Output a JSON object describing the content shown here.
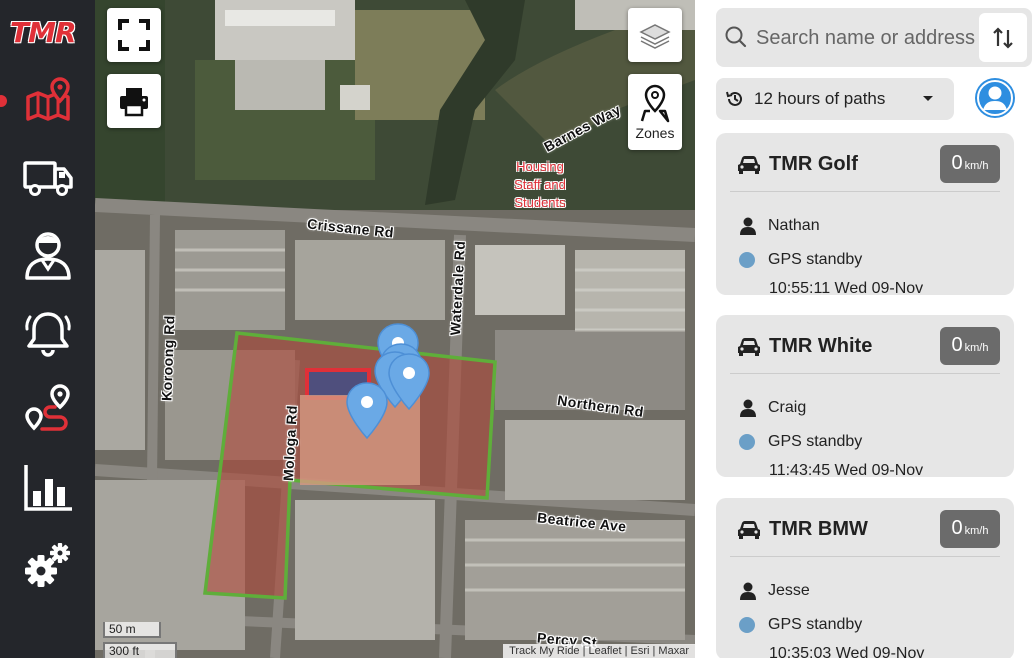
{
  "app": {
    "logo_text": "TMR"
  },
  "colors": {
    "brand_red": "#e03038",
    "sidebar_bg": "#24262b",
    "status_standby": "#6b9fc7",
    "speed_badge": "#6b6b6b",
    "avatar_blue": "#2e8ee0",
    "zone_green": "#5fae3a"
  },
  "sidebar": {
    "items": [
      {
        "name": "map",
        "icon": "map-pin-icon",
        "active": true
      },
      {
        "name": "vehicles",
        "icon": "truck-icon"
      },
      {
        "name": "drivers",
        "icon": "driver-icon"
      },
      {
        "name": "alerts",
        "icon": "bell-icon"
      },
      {
        "name": "routes",
        "icon": "route-icon"
      },
      {
        "name": "reports",
        "icon": "bar-chart-icon"
      },
      {
        "name": "settings",
        "icon": "gears-icon"
      }
    ]
  },
  "map": {
    "buttons": {
      "fullscreen": "fullscreen-icon",
      "print": "print-icon",
      "layers": "layers-icon",
      "zones_label": "Zones"
    },
    "roads": [
      "Barnes Way",
      "Crissane Rd",
      "Waterdale Rd",
      "Koroong Rd",
      "Mologa Rd",
      "Northern Rd",
      "Beatrice Ave",
      "Percy St"
    ],
    "place": [
      "Housing",
      "Staff and",
      "Students"
    ],
    "scale": {
      "metric": "50 m",
      "imperial": "300 ft"
    },
    "attribution": "Track My Ride | Leaflet | Esri | Maxar"
  },
  "search": {
    "placeholder": "Search name or address"
  },
  "paths": {
    "label": "12 hours of paths"
  },
  "vehicles": [
    {
      "name": "TMR Golf",
      "speed": "0",
      "unit": "km/h",
      "driver": "Nathan",
      "status": "GPS standby",
      "time": "10:55:11 Wed 09-Nov"
    },
    {
      "name": "TMR White",
      "speed": "0",
      "unit": "km/h",
      "driver": "Craig",
      "status": "GPS standby",
      "time": "11:43:45 Wed 09-Nov"
    },
    {
      "name": "TMR BMW",
      "speed": "0",
      "unit": "km/h",
      "driver": "Jesse",
      "status": "GPS standby",
      "time": "10:35:03 Wed 09-Nov"
    }
  ]
}
